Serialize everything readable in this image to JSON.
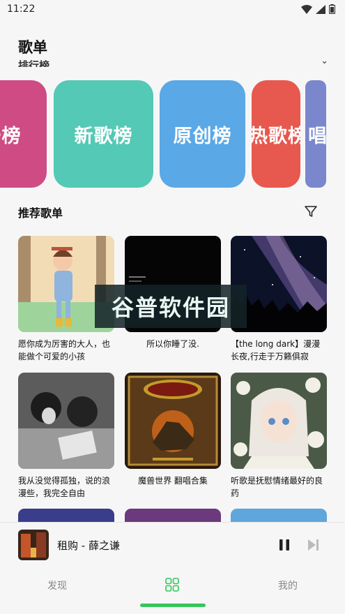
{
  "status_bar": {
    "time": "11:22"
  },
  "page_title": "歌单",
  "section_cut_label": "排行榜",
  "charts": [
    {
      "label": "飙升榜",
      "color": "#cf4b83"
    },
    {
      "label": "新歌榜",
      "color": "#54c9b5"
    },
    {
      "label": "原创榜",
      "color": "#5aa8e6"
    },
    {
      "label": "热歌榜",
      "color": "#e7584e"
    },
    {
      "label": "唱",
      "color": "#7a87cc"
    }
  ],
  "recommended": {
    "title": "推荐歌单",
    "playlists": [
      {
        "title": "愿你成为厉害的大人，也能做个可爱的小孩"
      },
      {
        "title": "所以你睡了没."
      },
      {
        "title": "【the long dark】漫漫长夜,行走于万籁俱寂"
      },
      {
        "title": "我从没觉得孤独，说的浪漫些，我完全自由"
      },
      {
        "title": "魔兽世界 翻唱合集"
      },
      {
        "title": "听歌是抚慰情绪最好的良药"
      }
    ]
  },
  "watermark": "谷普软件园",
  "now_playing": {
    "title": "租购 - 薛之谦"
  },
  "tabs": {
    "discover": "发现",
    "mine": "我的"
  },
  "colors": {
    "accent": "#34c759"
  }
}
